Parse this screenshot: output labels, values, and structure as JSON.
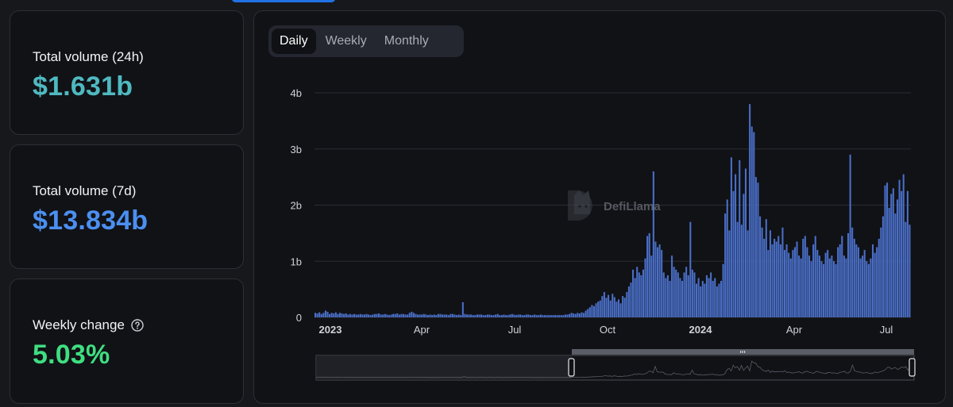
{
  "stats": {
    "total_24h": {
      "label": "Total volume (24h)",
      "value": "$1.631b"
    },
    "total_7d": {
      "label": "Total volume (7d)",
      "value": "$13.834b"
    },
    "weekly_change": {
      "label": "Weekly change",
      "value": "5.03%"
    }
  },
  "tabs": [
    {
      "label": "Daily",
      "active": true
    },
    {
      "label": "Weekly",
      "active": false
    },
    {
      "label": "Monthly",
      "active": false
    }
  ],
  "watermark": "DefiLlama",
  "colors": {
    "bar": "#4a6fc8",
    "pos_24h": "#4fb9c1",
    "pos_7d": "#4b8ff0",
    "change": "#3fde81"
  },
  "chart_data": {
    "type": "bar",
    "title": "",
    "xlabel": "",
    "ylabel": "",
    "x_tick_labels": [
      "2023",
      "Apr",
      "Jul",
      "Oct",
      "2024",
      "Apr",
      "Jul"
    ],
    "y_tick_labels": [
      "0",
      "1b",
      "2b",
      "3b",
      "4b"
    ],
    "ylim": [
      0,
      4000000000
    ],
    "grid": true,
    "series": [
      {
        "values_billions": [
          0.08,
          0.07,
          0.09,
          0.06,
          0.08,
          0.12,
          0.1,
          0.06,
          0.08,
          0.07,
          0.09,
          0.06,
          0.08,
          0.07,
          0.06,
          0.07,
          0.05,
          0.06,
          0.05,
          0.06,
          0.05,
          0.05,
          0.06,
          0.05,
          0.05,
          0.06,
          0.05,
          0.04,
          0.05,
          0.06,
          0.06,
          0.07,
          0.05,
          0.05,
          0.06,
          0.05,
          0.04,
          0.05,
          0.06,
          0.06,
          0.07,
          0.05,
          0.06,
          0.06,
          0.05,
          0.05,
          0.08,
          0.1,
          0.08,
          0.06,
          0.05,
          0.05,
          0.05,
          0.06,
          0.05,
          0.04,
          0.05,
          0.04,
          0.05,
          0.04,
          0.06,
          0.06,
          0.05,
          0.05,
          0.05,
          0.04,
          0.06,
          0.06,
          0.05,
          0.04,
          0.05,
          0.04,
          0.27,
          0.06,
          0.05,
          0.05,
          0.05,
          0.04,
          0.04,
          0.05,
          0.05,
          0.05,
          0.04,
          0.04,
          0.05,
          0.05,
          0.04,
          0.04,
          0.05,
          0.06,
          0.04,
          0.04,
          0.05,
          0.04,
          0.04,
          0.05,
          0.06,
          0.05,
          0.04,
          0.05,
          0.05,
          0.04,
          0.04,
          0.05,
          0.05,
          0.04,
          0.04,
          0.05,
          0.04,
          0.04,
          0.05,
          0.04,
          0.04,
          0.04,
          0.04,
          0.04,
          0.04,
          0.04,
          0.04,
          0.04,
          0.04,
          0.04,
          0.05,
          0.05,
          0.06,
          0.08,
          0.07,
          0.06,
          0.08,
          0.07,
          0.09,
          0.08,
          0.12,
          0.15,
          0.18,
          0.22,
          0.2,
          0.25,
          0.28,
          0.3,
          0.38,
          0.45,
          0.35,
          0.4,
          0.3,
          0.42,
          0.36,
          0.28,
          0.32,
          0.25,
          0.38,
          0.35,
          0.45,
          0.55,
          0.62,
          0.85,
          0.7,
          0.9,
          0.8,
          0.75,
          0.85,
          1.05,
          1.45,
          1.5,
          1.1,
          2.6,
          1.35,
          1.25,
          1.3,
          1.2,
          0.8,
          0.7,
          0.75,
          0.65,
          1.1,
          0.9,
          0.85,
          0.8,
          0.7,
          0.65,
          0.8,
          0.9,
          0.75,
          1.7,
          0.85,
          0.8,
          0.6,
          0.7,
          0.55,
          0.65,
          0.6,
          0.75,
          0.7,
          0.8,
          0.65,
          0.7,
          0.55,
          0.6,
          0.65,
          0.95,
          1.85,
          2.1,
          1.55,
          2.85,
          2.25,
          2.55,
          1.7,
          2.8,
          1.65,
          2.2,
          2.65,
          1.55,
          3.8,
          3.4,
          3.3,
          2.5,
          2.4,
          1.8,
          1.6,
          1.4,
          1.75,
          1.2,
          1.55,
          1.3,
          1.4,
          1.35,
          1.45,
          1.3,
          1.6,
          1.2,
          1.3,
          1.15,
          1.05,
          1.2,
          1.25,
          1.35,
          1.1,
          1.05,
          1.4,
          1.45,
          1.25,
          1.1,
          1.0,
          1.3,
          1.45,
          1.2,
          1.1,
          1.0,
          0.95,
          1.15,
          1.2,
          1.05,
          1.1,
          1.0,
          0.95,
          1.25,
          1.3,
          1.45,
          1.1,
          1.05,
          1.5,
          2.9,
          1.6,
          1.4,
          1.3,
          1.25,
          1.05,
          1.1,
          1.2,
          1.0,
          0.95,
          1.05,
          1.3,
          1.15,
          1.25,
          1.4,
          1.6,
          1.8,
          2.35,
          2.4,
          1.95,
          2.2,
          2.3,
          1.85,
          2.1,
          2.45,
          2.25,
          2.55,
          1.7,
          2.25,
          1.65
        ]
      }
    ]
  }
}
